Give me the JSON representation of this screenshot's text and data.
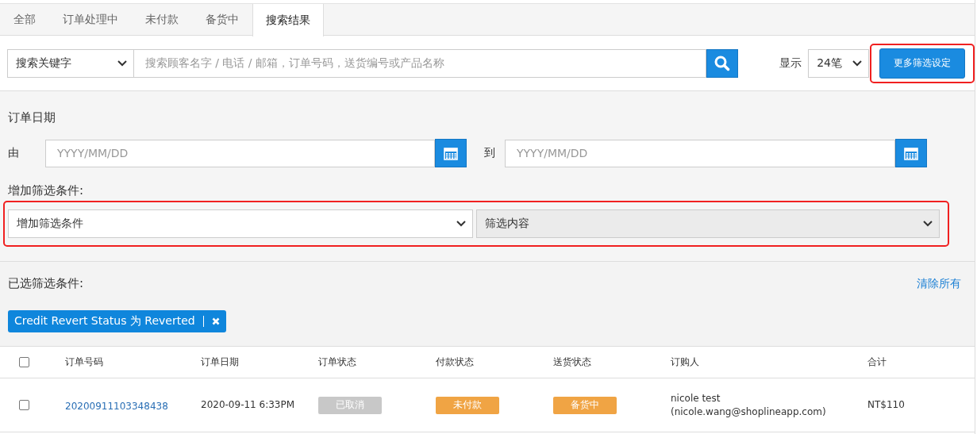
{
  "tabs": [
    {
      "label": "全部",
      "selected": false
    },
    {
      "label": "订单处理中",
      "selected": false
    },
    {
      "label": "未付款",
      "selected": false
    },
    {
      "label": "备货中",
      "selected": false
    },
    {
      "label": "搜索结果",
      "selected": true
    }
  ],
  "search": {
    "scope": "搜索关键字",
    "placeholder": "搜索顾客名字 / 电话 / 邮箱，订单号码，送货编号或产品名称",
    "show_label": "显示",
    "page_size": "24笔",
    "more_button": "更多筛选设定"
  },
  "filters": {
    "date_title": "订单日期",
    "from_label": "由",
    "from_placeholder": "YYYY/MM/DD",
    "to_label": "到",
    "to_placeholder": "YYYY/MM/DD",
    "add_title": "增加筛选条件:",
    "condition": "增加筛选条件",
    "content": "筛选内容",
    "content_disabled": true
  },
  "selected_filters": {
    "title": "已选筛选条件:",
    "clear": "清除所有",
    "tags": [
      {
        "label": "Credit Revert Status 为 Reverted"
      }
    ]
  },
  "table": {
    "columns": [
      "订单号码",
      "订单日期",
      "订单状态",
      "付款状态",
      "送货状态",
      "订购人",
      "合计"
    ],
    "all_checked": false,
    "rows": [
      {
        "checked": false,
        "order_no": "20200911103348438",
        "date": "2020-09-11 6:33PM",
        "statuses": [
          {
            "label": "已取消",
            "color": "#c8c8c8"
          },
          {
            "label": "未付款",
            "color": "#f0a444"
          },
          {
            "label": "备货中",
            "color": "#f0a444"
          }
        ],
        "buyer_name": "nicole test",
        "buyer_email": "(nicole.wang@shoplineapp.com)",
        "total": "NT$110"
      }
    ]
  }
}
